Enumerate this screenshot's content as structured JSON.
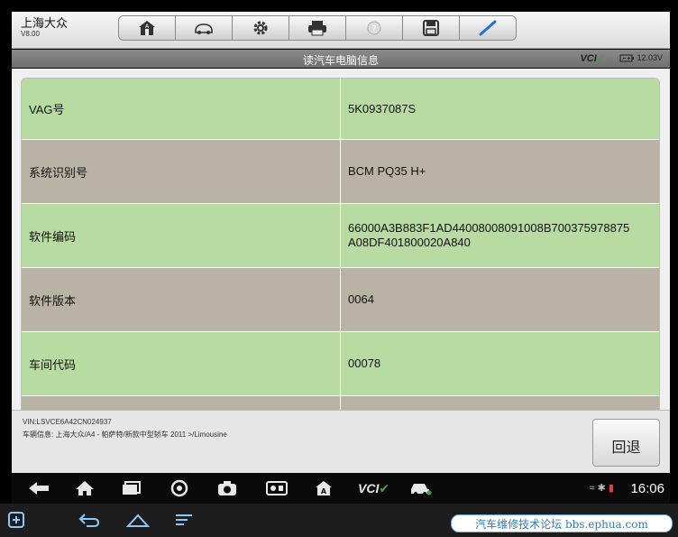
{
  "app": {
    "brand": "上海大众",
    "version": "V8.00"
  },
  "toolbar": {
    "buttons": [
      "home-icon",
      "vehicle-icon",
      "gear-icon",
      "print-icon",
      "help-icon",
      "save-icon",
      "pen-icon"
    ]
  },
  "titlebar": {
    "title": "读汽车电脑信息",
    "vci": "VCI",
    "battery": "12.03V"
  },
  "table": {
    "rows": [
      {
        "key": "VAG号",
        "value": "5K0937087S"
      },
      {
        "key": "系统识别号",
        "value": "BCM PQ35 H+"
      },
      {
        "key": "软件编码",
        "value": "66000A3B883F1AD44008008091008B700375978875 A08DF401800020A840"
      },
      {
        "key": "软件版本",
        "value": "0064"
      },
      {
        "key": "车间代码",
        "value": "00078"
      },
      {
        "key": "",
        "value": ""
      }
    ]
  },
  "footer": {
    "vin": "VIN:LSVCE6A42CN024937",
    "vehicle": "车辆信息: 上海大众/A4 - 帕萨特/新款中型轿车 2011 >/Limousine",
    "back_label": "回退"
  },
  "taskbar": {
    "vci_label": "VCI",
    "time": "16:06"
  },
  "watermark": "汽车维修技术论坛 bbs.ephua.com",
  "colors": {
    "green_row": "#b8dba2",
    "gray_row": "#b9b3a6",
    "accent": "#43a047"
  }
}
